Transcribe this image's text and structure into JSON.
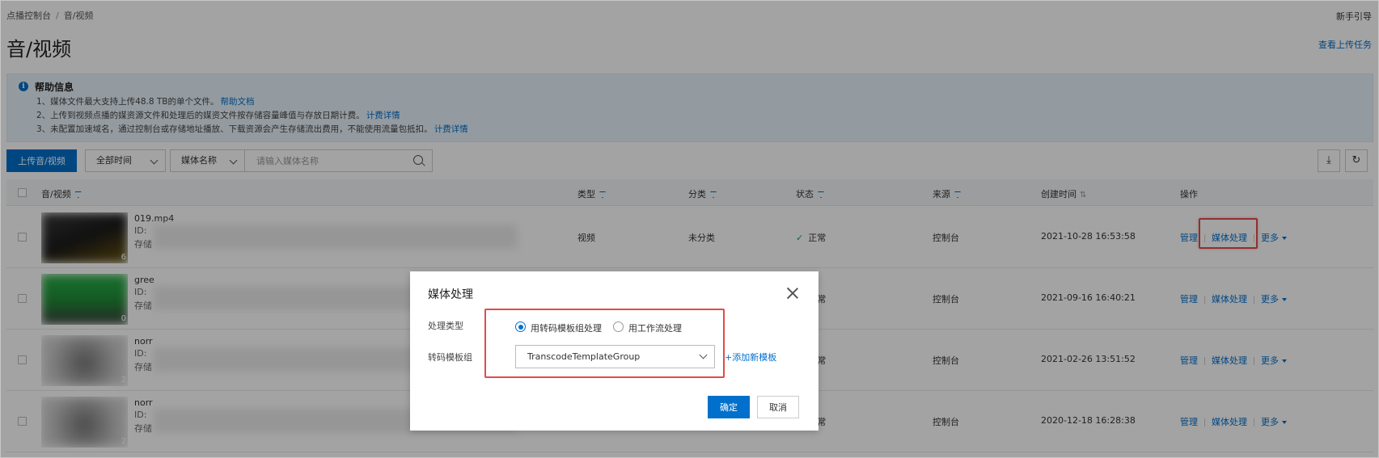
{
  "breadcrumb": {
    "root": "点播控制台",
    "separator": "/",
    "current": "音/视频"
  },
  "header": {
    "guide": "新手引导",
    "title": "音/视频",
    "upload_tasks": "查看上传任务"
  },
  "help": {
    "title": "帮助信息",
    "lines": [
      {
        "text": "1、媒体文件最大支持上传48.8 TB的单个文件。",
        "link": "帮助文档"
      },
      {
        "text": "2、上传到视频点播的媒资源文件和处理后的媒资文件按存储容量峰值与存放日期计费。",
        "link": "计费详情"
      },
      {
        "text": "3、未配置加速域名，通过控制台或存储地址播放、下载资源会产生存储流出费用，不能使用流量包抵扣。",
        "link": "计费详情"
      }
    ]
  },
  "toolbar": {
    "upload_label": "上传音/视频",
    "time_filter": "全部时间",
    "field_filter": "媒体名称",
    "search_placeholder": "请输入媒体名称"
  },
  "table": {
    "headers": {
      "media": "音/视频",
      "type": "类型",
      "category": "分类",
      "status": "状态",
      "source": "来源",
      "created": "创建时间",
      "actions": "操作"
    },
    "rows": [
      {
        "name": "019.mp4",
        "id_label": "ID:",
        "store_label": "存储",
        "type": "视频",
        "category": "未分类",
        "status": "正常",
        "source": "控制台",
        "created": "2021-10-28 16:53:58",
        "duration": "6"
      },
      {
        "name": "gree",
        "id_label": "ID:",
        "store_label": "存储",
        "type": "",
        "category": "",
        "status": "正常",
        "source": "控制台",
        "created": "2021-09-16 16:40:21",
        "duration": "0"
      },
      {
        "name": "norr",
        "id_label": "ID:",
        "store_label": "存储",
        "type": "",
        "category": "",
        "status": "正常",
        "source": "控制台",
        "created": "2021-02-26 13:51:52",
        "duration": "2"
      },
      {
        "name": "norr",
        "id_label": "ID:",
        "store_label": "存储",
        "type": "",
        "category": "",
        "status": "正常",
        "source": "控制台",
        "created": "2020-12-18 16:28:38",
        "duration": "2"
      }
    ],
    "ops": {
      "manage": "管理",
      "process": "媒体处理",
      "more": "更多"
    }
  },
  "dialog": {
    "title": "媒体处理",
    "type_label": "处理类型",
    "option_template": "用转码模板组处理",
    "option_workflow": "用工作流处理",
    "template_label": "转码模板组",
    "template_value": "TranscodeTemplateGroup",
    "add_template": "+添加新模板",
    "ok": "确定",
    "cancel": "取消"
  },
  "colors": {
    "primary": "#0070cc",
    "highlight": "#e04b4b",
    "success": "#23a046"
  }
}
